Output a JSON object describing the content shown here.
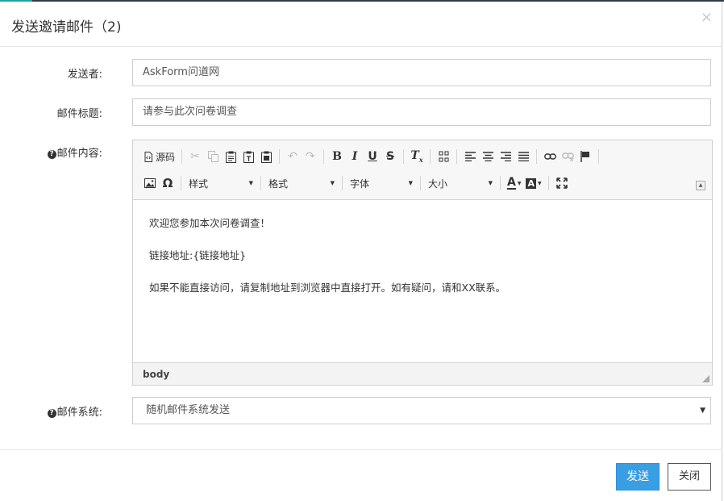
{
  "dialog": {
    "title": "发送邀请邮件（2)",
    "close_glyph": "×"
  },
  "form": {
    "sender": {
      "label": "发送者:",
      "value": "AskForm问道网"
    },
    "subject": {
      "label": "邮件标题:",
      "value": "请参与此次问卷调查"
    },
    "content": {
      "label": "邮件内容:",
      "help_glyph": "?"
    },
    "system": {
      "label": "邮件系统:",
      "help_glyph": "?",
      "selected": "随机邮件系统发送"
    }
  },
  "editor": {
    "source_label": "源码",
    "combos": {
      "styles": "样式",
      "format": "格式",
      "font": "字体",
      "size": "大小"
    },
    "paragraphs": [
      "欢迎您参加本次问卷调查！",
      "链接地址:{链接地址}",
      "如果不能直接访问，请复制地址到浏览器中直接打开。如有疑问，请和XX联系。"
    ],
    "element_path": "body",
    "icons": [
      "source-icon",
      "cut-icon",
      "copy-icon",
      "paste-icon",
      "paste-text-icon",
      "paste-word-icon",
      "undo-icon",
      "redo-icon",
      "bold-icon",
      "italic-icon",
      "underline-icon",
      "strike-icon",
      "remove-format-icon",
      "unlink-format-icon",
      "align-left-icon",
      "align-center-icon",
      "align-right-icon",
      "align-justify-icon",
      "link-icon",
      "unlink-icon",
      "anchor-flag-icon",
      "image-icon",
      "omega-icon",
      "text-color-icon",
      "bg-color-icon",
      "maximize-icon"
    ]
  },
  "footer": {
    "send_label": "发送",
    "close_label": "关闭"
  },
  "colors": {
    "primary": "#3a9ee4",
    "border": "#cccccc"
  }
}
